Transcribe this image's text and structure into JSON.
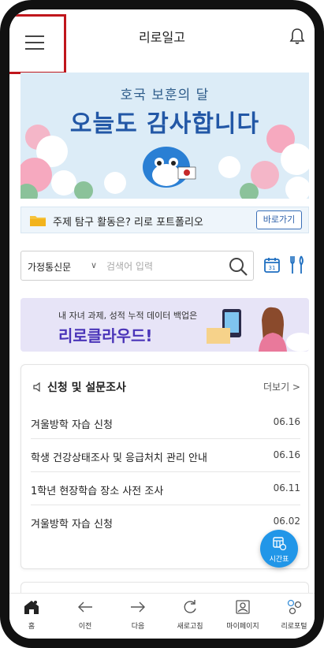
{
  "header": {
    "title": "리로일고",
    "menu_icon": "hamburger-icon",
    "bell_icon": "bell-icon",
    "highlight_color": "#c0161c"
  },
  "banner": {
    "subtitle": "호국 보훈의 달",
    "title": "오늘도 감사합니다"
  },
  "portfolio": {
    "text": "주제 탐구 활동은? 리로 포트폴리오",
    "button": "바로가기"
  },
  "search": {
    "category": "가정통신문",
    "placeholder": "검색어 입력"
  },
  "cloud_banner": {
    "subtitle": "내 자녀 과제, 성적 누적 데이터 백업은",
    "title": "리로클라우드!"
  },
  "notices": {
    "title": "신청 및 설문조사",
    "more": "더보기 >",
    "items": [
      {
        "text": "겨울방학 자습 신청",
        "date": "06.16"
      },
      {
        "text": "학생 건강상태조사 및 응급처치 관리 안내",
        "date": "06.16"
      },
      {
        "text": "1학년 현장학습 장소 사전 조사",
        "date": "06.11"
      },
      {
        "text": "겨울방학 자습 신청",
        "date": "06.02"
      }
    ]
  },
  "fab": {
    "label": "시간표"
  },
  "bottom_nav": {
    "items": [
      {
        "label": "홈",
        "icon": "home-icon"
      },
      {
        "label": "이전",
        "icon": "arrow-left-icon"
      },
      {
        "label": "다음",
        "icon": "arrow-right-icon"
      },
      {
        "label": "새로고침",
        "icon": "refresh-icon"
      },
      {
        "label": "마이페이지",
        "icon": "mypage-icon"
      },
      {
        "label": "리로포털",
        "icon": "portal-icon"
      }
    ]
  },
  "colors": {
    "accent_blue": "#2257a6",
    "fab_blue": "#2196e8",
    "cloud_purple": "#4a34b8"
  }
}
